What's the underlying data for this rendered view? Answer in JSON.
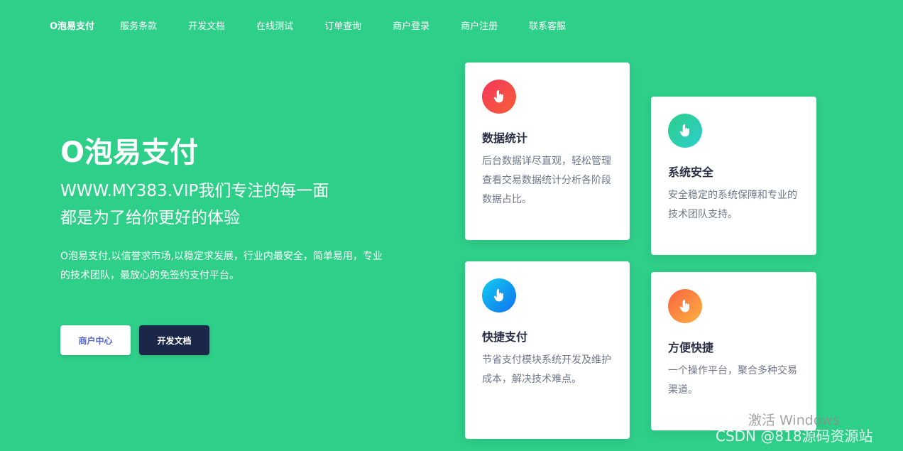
{
  "nav": {
    "brand": "O泡易支付",
    "links": [
      "服务条款",
      "开发文档",
      "在线测试",
      "订单查询",
      "商户登录",
      "商户注册",
      "联系客服"
    ]
  },
  "hero": {
    "title": "O泡易支付",
    "subtitle_line1": "WWW.MY383.VIP我们专注的每一面",
    "subtitle_line2": "都是为了给你更好的体验",
    "description": "O泡易支付,以信誉求市场,以稳定求发展，行业内最安全，简单易用，专业的技术团队，最放心的免签约支付平台。",
    "btn_merchant": "商户中心",
    "btn_docs": "开发文档"
  },
  "features": [
    {
      "title": "数据统计",
      "desc": "后台数据详尽直观，轻松管理查看交易数据统计分析各阶段数据占比。",
      "icon": "pointing-hand-icon",
      "color": "#f5365c"
    },
    {
      "title": "系统安全",
      "desc": "安全稳定的系统保障和专业的技术团队支持。",
      "icon": "pointing-hand-icon",
      "color": "#2dce89"
    },
    {
      "title": "快捷支付",
      "desc": "节省支付模块系统开发及维护成本，解决技术难点。",
      "icon": "pointing-hand-icon",
      "color": "#11cdef"
    },
    {
      "title": "方便快捷",
      "desc": "一个操作平台，聚合多种交易渠道。",
      "icon": "pointing-hand-icon",
      "color": "#fb6340"
    }
  ],
  "overlay": {
    "watermark": "激活 Windows",
    "csdn": "CSDN @818源码资源站"
  },
  "colors": {
    "background": "#2ecf88",
    "dark_button": "#1b2749",
    "light_button_text": "#5a67c8"
  }
}
